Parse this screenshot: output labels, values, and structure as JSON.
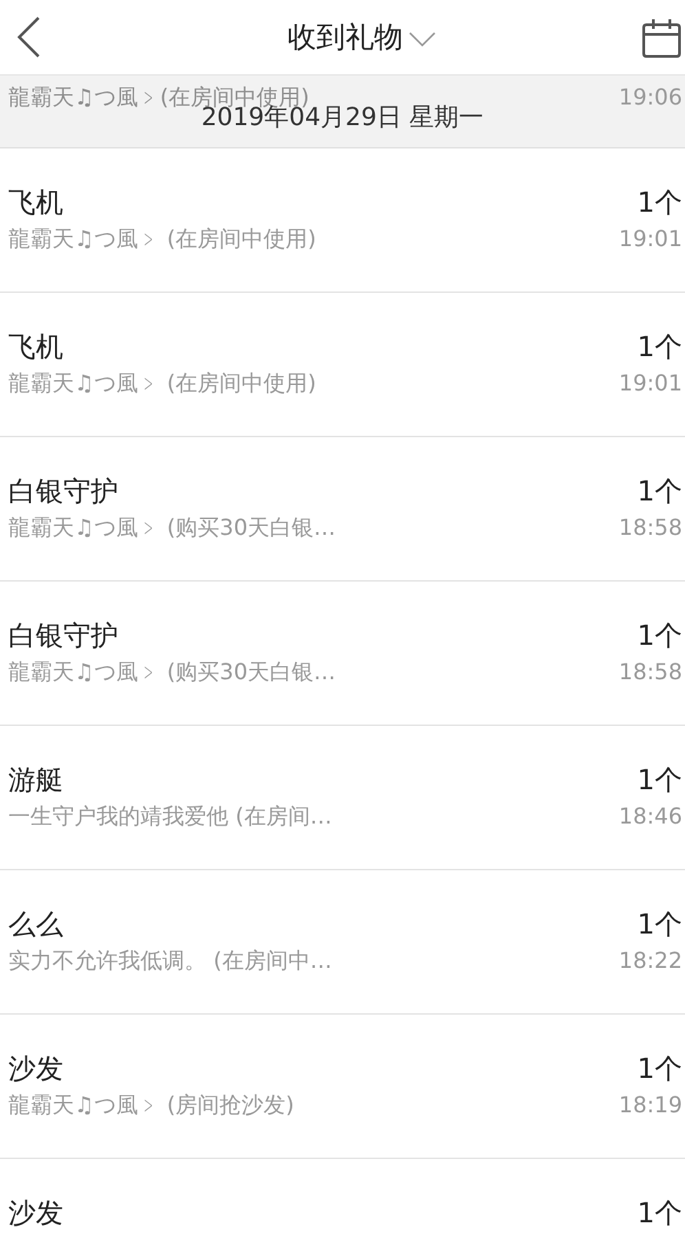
{
  "header": {
    "title": "收到礼物"
  },
  "date_header": {
    "date": "2019年04月29日 星期一",
    "covered_row": {
      "subtitle": "龍霸天♫つ風﹥(在房间中使用)",
      "time": "19:06"
    }
  },
  "gifts": [
    {
      "name": "飞机",
      "subtitle": "龍霸天♫つ風﹥ (在房间中使用)",
      "count": "1个",
      "time": "19:01"
    },
    {
      "name": "飞机",
      "subtitle": "龍霸天♫つ風﹥ (在房间中使用)",
      "count": "1个",
      "time": "19:01"
    },
    {
      "name": "白银守护",
      "subtitle": "龍霸天♫つ風﹥ (购买30天白银…",
      "count": "1个",
      "time": "18:58"
    },
    {
      "name": "白银守护",
      "subtitle": "龍霸天♫つ風﹥ (购买30天白银…",
      "count": "1个",
      "time": "18:58"
    },
    {
      "name": "游艇",
      "subtitle": "一生守户我的靖我爱他 (在房间…",
      "count": "1个",
      "time": "18:46"
    },
    {
      "name": "么么",
      "subtitle": "实力不允许我低调。 (在房间中…",
      "count": "1个",
      "time": "18:22"
    },
    {
      "name": "沙发",
      "subtitle": "龍霸天♫つ風﹥ (房间抢沙发)",
      "count": "1个",
      "time": "18:19"
    },
    {
      "name": "沙发",
      "count": "1个"
    }
  ]
}
